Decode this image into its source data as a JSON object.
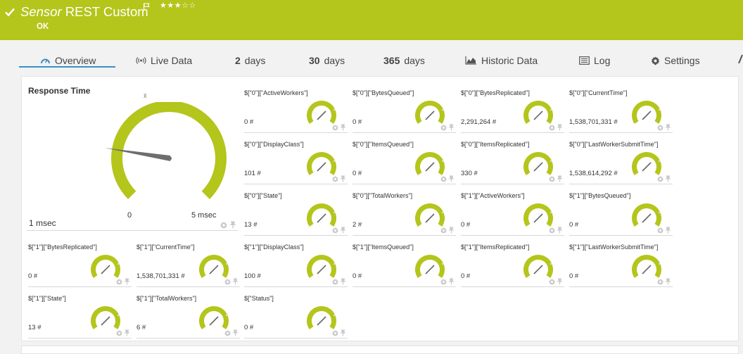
{
  "header": {
    "title_italic": "Sensor",
    "title_rest": "REST Custom",
    "stars": "★★★☆☆",
    "status": "OK",
    "brand_color": "#b4c51b"
  },
  "tabs": [
    {
      "label": "Overview",
      "icon": "gauge-icon",
      "active": true
    },
    {
      "label": "Live Data",
      "icon": "live-data-icon"
    },
    {
      "num": "2",
      "label": "days"
    },
    {
      "num": "30",
      "label": "days"
    },
    {
      "num": "365",
      "label": "days"
    },
    {
      "label": "Historic Data",
      "icon": "area-chart-icon"
    },
    {
      "label": "Log",
      "icon": "log-icon"
    },
    {
      "label": "Settings",
      "icon": "gear-icon"
    }
  ],
  "main_gauge": {
    "label": "Response Time",
    "marker": "x̄",
    "min_label": "0",
    "max_label": "5 msec",
    "value_label": "1 msec",
    "fraction": 0.2
  },
  "channels": [
    {
      "label": "$[\"0\"][\"ActiveWorkers\"]",
      "value": "0 #"
    },
    {
      "label": "$[\"0\"][\"BytesQueued\"]",
      "value": "0 #"
    },
    {
      "label": "$[\"0\"][\"BytesReplicated\"]",
      "value": "2,291,264 #"
    },
    {
      "label": "$[\"0\"][\"CurrentTime\"]",
      "value": "1,538,701,331 #"
    },
    {
      "label": "$[\"0\"][\"DisplayClass\"]",
      "value": "101 #"
    },
    {
      "label": "$[\"0\"][\"ItemsQueued\"]",
      "value": "0 #"
    },
    {
      "label": "$[\"0\"][\"ItemsReplicated\"]",
      "value": "330 #"
    },
    {
      "label": "$[\"0\"][\"LastWorkerSubmitTime\"]",
      "value": "1,538,614,292 #"
    },
    {
      "label": "$[\"0\"][\"State\"]",
      "value": "13 #"
    },
    {
      "label": "$[\"0\"][\"TotalWorkers\"]",
      "value": "2 #"
    },
    {
      "label": "$[\"1\"][\"ActiveWorkers\"]",
      "value": "0 #"
    },
    {
      "label": "$[\"1\"][\"BytesQueued\"]",
      "value": "0 #"
    },
    {
      "label": "$[\"1\"][\"BytesReplicated\"]",
      "value": "0 #"
    },
    {
      "label": "$[\"1\"][\"CurrentTime\"]",
      "value": "1,538,701,331 #"
    },
    {
      "label": "$[\"1\"][\"DisplayClass\"]",
      "value": "100 #"
    },
    {
      "label": "$[\"1\"][\"ItemsQueued\"]",
      "value": "0 #"
    },
    {
      "label": "$[\"1\"][\"ItemsReplicated\"]",
      "value": "0 #"
    },
    {
      "label": "$[\"1\"][\"LastWorkerSubmitTime\"]",
      "value": "0 #"
    },
    {
      "label": "$[\"1\"][\"State\"]",
      "value": "13 #"
    },
    {
      "label": "$[\"1\"][\"TotalWorkers\"]",
      "value": "6 #"
    },
    {
      "label": "$[\"Status\"]",
      "value": "0 #"
    }
  ]
}
